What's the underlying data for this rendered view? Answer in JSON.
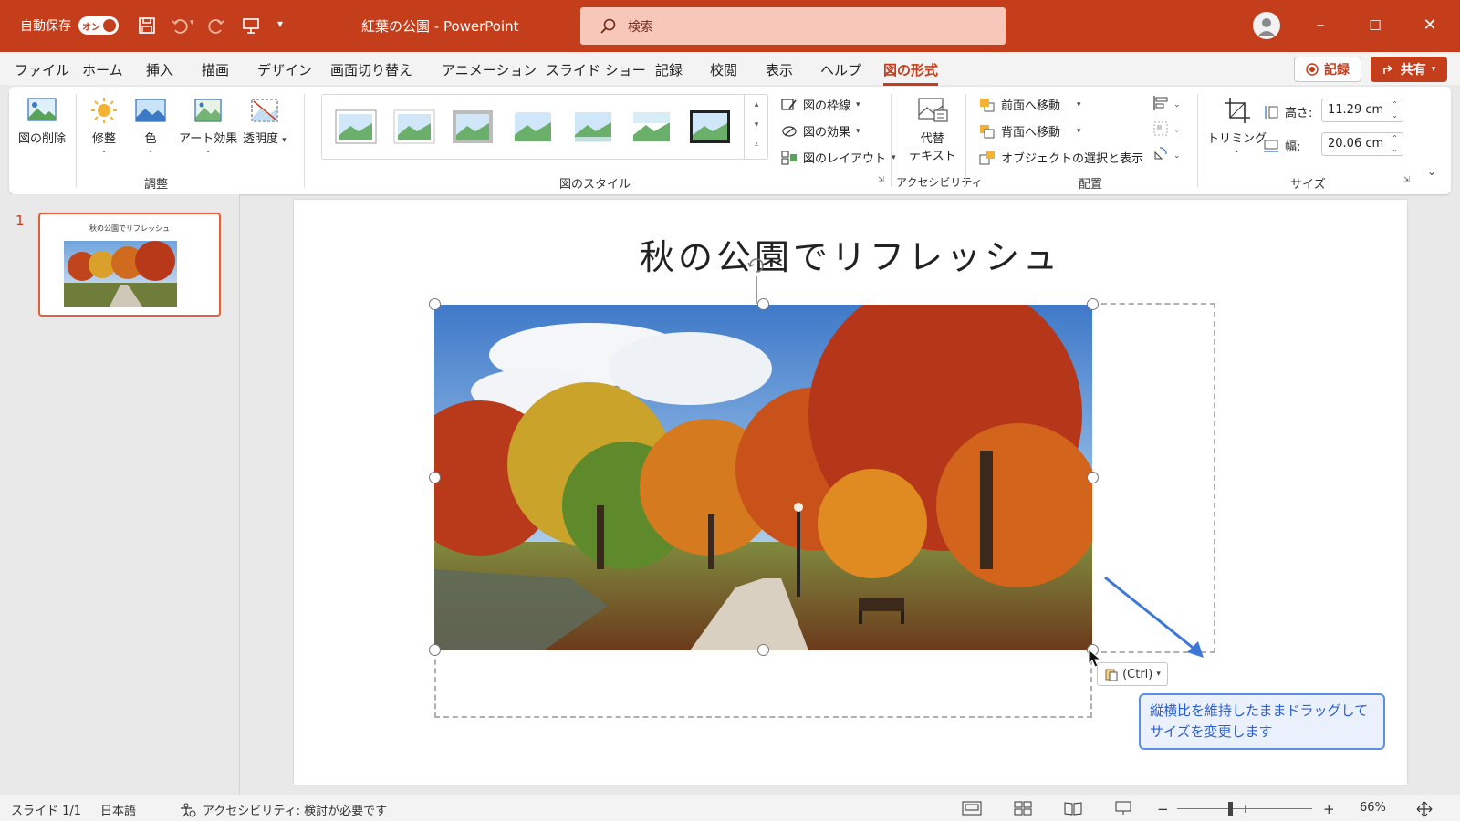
{
  "window": {
    "autosave_label": "自動保存",
    "autosave_state": "オン",
    "doc_title": "紅葉の公園 - PowerPoint",
    "search_placeholder": "検索"
  },
  "menu": {
    "tabs": [
      {
        "label": "ファイル"
      },
      {
        "label": "ホーム"
      },
      {
        "label": "挿入"
      },
      {
        "label": "描画"
      },
      {
        "label": "デザイン"
      },
      {
        "label": "画面切り替え"
      },
      {
        "label": "アニメーション"
      },
      {
        "label": "スライド ショー"
      },
      {
        "label": "記録"
      },
      {
        "label": "校閲"
      },
      {
        "label": "表示"
      },
      {
        "label": "ヘルプ"
      },
      {
        "label": "図の形式"
      }
    ],
    "record_label": "記録",
    "share_label": "共有"
  },
  "ribbon": {
    "remove_bg": "図の削除",
    "corrections": "修整",
    "color": "色",
    "artistic": "アート効果",
    "transparency": "透明度",
    "group_adjust": "調整",
    "picture_border": "図の枠線",
    "picture_effects": "図の効果",
    "picture_layout": "図のレイアウト",
    "group_styles": "図のスタイル",
    "alt_text_line1": "代替",
    "alt_text_line2": "テキスト",
    "group_accessibility": "アクセシビリティ",
    "bring_forward": "前面へ移動",
    "send_backward": "背面へ移動",
    "selection_pane": "オブジェクトの選択と表示",
    "group_arrange": "配置",
    "crop": "トリミング",
    "height_label": "高さ:",
    "height_value": "11.29 cm",
    "width_label": "幅:",
    "width_value": "20.06 cm",
    "group_size": "サイズ"
  },
  "thumbnails": {
    "slide_number": "1",
    "slide_title": "秋の公園でリフレッシュ"
  },
  "slide": {
    "title": "秋の公園でリフレッシュ",
    "paste_options": "(Ctrl)",
    "callout": "縦横比を維持したままドラッグしてサイズを変更します"
  },
  "status": {
    "slide_counter": "スライド 1/1",
    "language": "日本語",
    "accessibility": "アクセシビリティ: 検討が必要です",
    "zoom": "66%"
  },
  "colors": {
    "accent": "#c43e1c",
    "callout_border": "#5b8fe6",
    "callout_text": "#2c5fcf"
  }
}
